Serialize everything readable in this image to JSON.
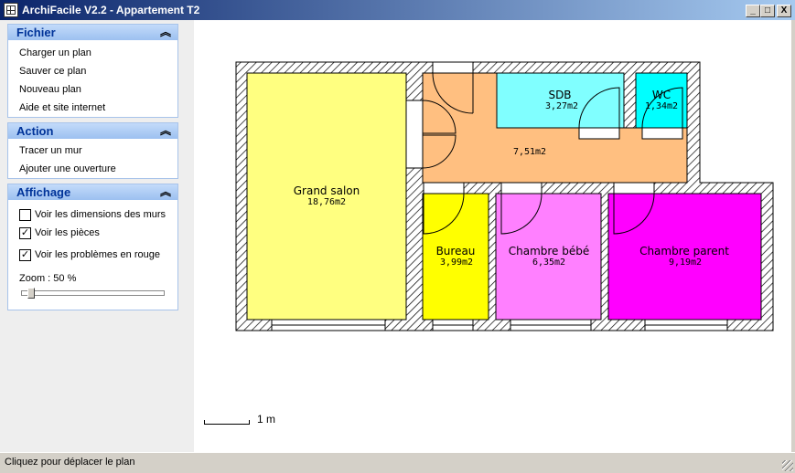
{
  "window": {
    "title": "ArchiFacile V2.2 - Appartement T2",
    "minimize": "_",
    "maximize": "□",
    "close": "X"
  },
  "sidebar": {
    "fichier": {
      "title": "Fichier",
      "collapse": "︽",
      "items": [
        "Charger un plan",
        "Sauver ce plan",
        "Nouveau plan",
        "Aide et site internet"
      ]
    },
    "action": {
      "title": "Action",
      "collapse": "︽",
      "items": [
        "Tracer un mur",
        "Ajouter une ouverture"
      ]
    },
    "affichage": {
      "title": "Affichage",
      "collapse": "︽",
      "options": [
        {
          "label": "Voir les dimensions des murs",
          "checked": false,
          "mark": ""
        },
        {
          "label": "Voir les pièces",
          "checked": true,
          "mark": "✓"
        },
        {
          "label": "Voir les problèmes en rouge",
          "checked": true,
          "mark": "✓"
        }
      ],
      "zoom_label": "Zoom : 50 %",
      "zoom_value": 0.05
    }
  },
  "plan": {
    "rooms": [
      {
        "name": "Grand salon",
        "area": "18,76m2",
        "color": "#ffff80"
      },
      {
        "name": "",
        "area": "7,51m2",
        "color": "#ffbf80"
      },
      {
        "name": "SDB",
        "area": "3,27m2",
        "color": "#80ffff"
      },
      {
        "name": "WC",
        "area": "1,34m2",
        "color": "#00ffff"
      },
      {
        "name": "Bureau",
        "area": "3,99m2",
        "color": "#ffff00"
      },
      {
        "name": "Chambre bébé",
        "area": "6,35m2",
        "color": "#ff80ff"
      },
      {
        "name": "Chambre parent",
        "area": "9,19m2",
        "color": "#ff00ff"
      }
    ],
    "scale_label": "1 m"
  },
  "status": {
    "text": "Cliquez pour déplacer le plan"
  }
}
